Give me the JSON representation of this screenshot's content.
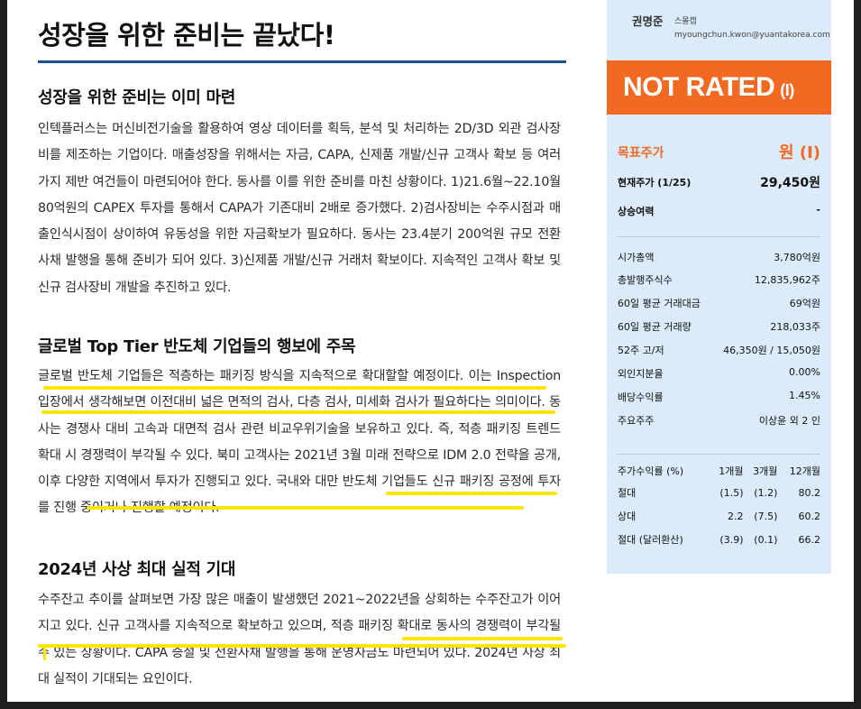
{
  "article": {
    "title": "성장을 위한 준비는 끝났다!",
    "sections": [
      {
        "heading": "성장을 위한 준비는 이미 마련",
        "body": "인텍플러스는 머신비전기술을 활용하여 영상 데이터를 획득, 분석 및 처리하는 2D/3D 외관 검사장비를 제조하는 기업이다. 매출성장을 위해서는 자금, CAPA, 신제품 개발/신규 고객사 확보 등 여러가지 제반 여건들이 마련되어야 한다. 동사를 이를 위한 준비를 마친 상황이다. 1)21.6월~22.10월 80억원의 CAPEX 투자를 통해서 CAPA가 기존대비 2배로 증가했다. 2)검사장비는 수주시점과 매출인식시점이 상이하여 유동성을 위한 자금확보가 필요하다. 동사는 23.4분기 200억원 규모 전환사채 발행을 통해 준비가 되어 있다. 3)신제품 개발/신규 거래처 확보이다. 지속적인 고객사 확보 및 신규 검사장비 개발을 추진하고 있다."
      },
      {
        "heading": "글로벌 Top Tier 반도체 기업들의 행보에 주목",
        "body": "글로벌 반도체 기업들은 적층하는 패키징 방식을 지속적으로 확대할할 예정이다. 이는 Inspection 입장에서 생각해보면 이전대비 넓은 면적의 검사, 다층 검사, 미세화 검사가 필요하다는 의미이다. 동사는 경쟁사 대비 고속과 대면적 검사 관련 비교우위기술을 보유하고 있다. 즉, 적층 패키징 트렌드 확대 시 경쟁력이 부각될 수 있다. 북미 고객사는 2021년 3월 미래 전략으로 IDM 2.0 전략을 공개, 이후 다양한 지역에서 투자가 진행되고 있다. 국내와 대만 반도체 기업들도 신규 패키징 공정에 투자를 진행 중이거나 진행할 예정이다."
      },
      {
        "heading": "2024년 사상 최대 실적 기대",
        "body": "수주잔고 추이를 살펴보면 가장 많은 매출이 발생했던 2021~2022년을 상회하는 수주잔고가 이어지고 있다. 신규 고객사를 지속적으로 확보하고 있으며, 적층 패키징 확대로 동사의 경쟁력이 부각될 수 있는 상황이다. CAPA 증설 및 전환사채 발행을 통해 운영자금도 마련되어 있다. 2024년 사상 최대 실적이 기대되는 요인이다."
      }
    ]
  },
  "sidebar": {
    "analyst": {
      "name": "권명준",
      "team": "스몰캡",
      "email": "myoungchun.kwon@yuantakorea.com"
    },
    "rating": {
      "main": "NOT RATED",
      "sub": "(I)"
    },
    "target_price": {
      "label": "목표주가",
      "value": "원 (I)"
    },
    "price_rows": [
      {
        "label": "현재주가 (1/25)",
        "value": "29,450원"
      },
      {
        "label": "상승여력",
        "value": "-"
      }
    ],
    "stats": [
      {
        "label": "시가총액",
        "value": "3,780억원"
      },
      {
        "label": "총발행주식수",
        "value": "12,835,962주"
      },
      {
        "label": "60일 평균 거래대금",
        "value": "69억원"
      },
      {
        "label": "60일 평균 거래량",
        "value": "218,033주"
      },
      {
        "label": "52주 고/저",
        "value": "46,350원 / 15,050원"
      },
      {
        "label": "외인지분율",
        "value": "0.00%"
      },
      {
        "label": "배당수익률",
        "value": "1.45%"
      },
      {
        "label": "주요주주",
        "value": "이상윤 외 2 인"
      }
    ],
    "performance": {
      "header": [
        "주가수익률 (%)",
        "1개월",
        "3개월",
        "12개월"
      ],
      "rows": [
        [
          "절대",
          "(1.5)",
          "(1.2)",
          "80.2"
        ],
        [
          "상대",
          "2.2",
          "(7.5)",
          "60.2"
        ],
        [
          "절대 (달러환산)",
          "(3.9)",
          "(0.1)",
          "66.2"
        ]
      ]
    }
  },
  "colors": {
    "accent_orange": "#f26a21",
    "rule_blue": "#1c4e8f",
    "sidebar_bg": "#dcebf9",
    "highlight": "#ffe600"
  }
}
